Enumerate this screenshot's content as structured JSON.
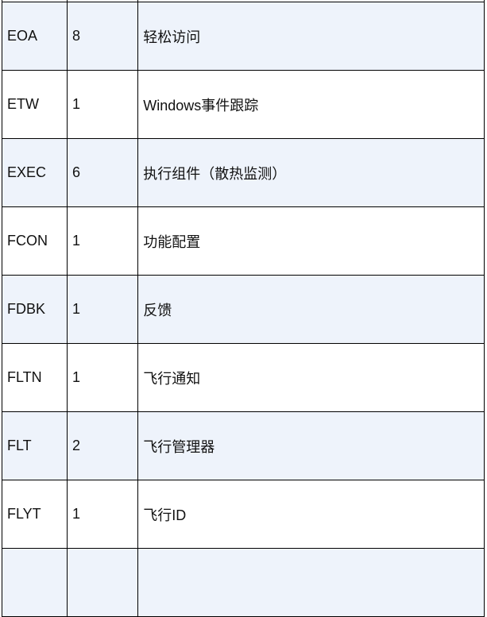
{
  "rows": [
    {
      "code": "",
      "count": "",
      "desc": ""
    },
    {
      "code": "EOA",
      "count": "8",
      "desc": "轻松访问"
    },
    {
      "code": "ETW",
      "count": "1",
      "desc": "Windows事件跟踪"
    },
    {
      "code": "EXEC",
      "count": "6",
      "desc": "执行组件（散热监测）"
    },
    {
      "code": "FCON",
      "count": "1",
      "desc": "功能配置"
    },
    {
      "code": "FDBK",
      "count": "1",
      "desc": "反馈"
    },
    {
      "code": "FLTN",
      "count": "1",
      "desc": "飞行通知"
    },
    {
      "code": "FLT",
      "count": "2",
      "desc": "飞行管理器"
    },
    {
      "code": "FLYT",
      "count": "1",
      "desc": "飞行ID"
    },
    {
      "code": "",
      "count": "",
      "desc": ""
    }
  ],
  "colors": {
    "alt_row": "#eef3fb",
    "border": "#000000"
  }
}
